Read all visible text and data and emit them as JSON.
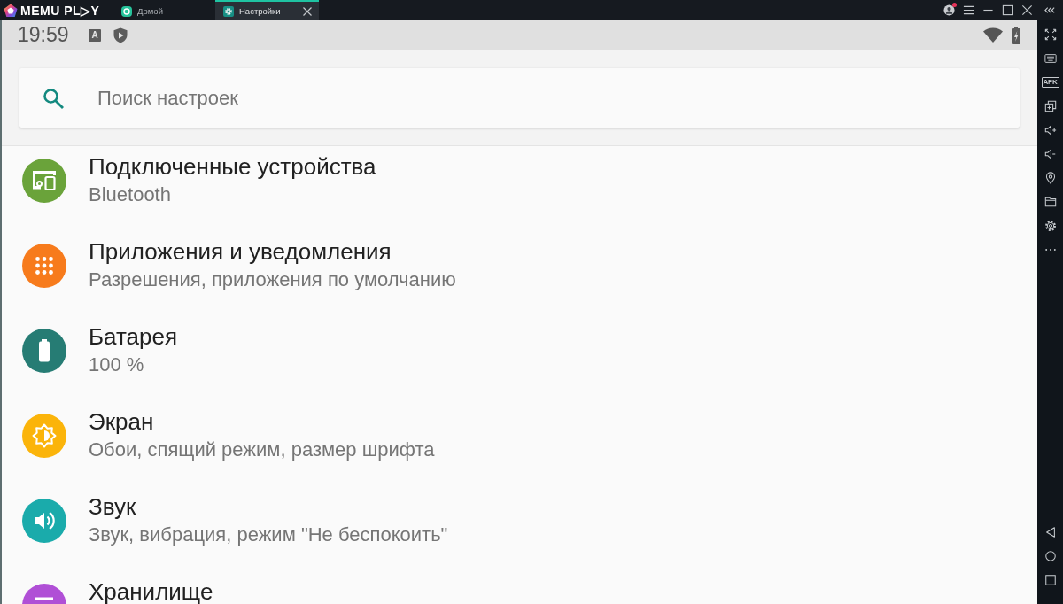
{
  "window": {
    "logo": "MEMU PL▷Y",
    "tabs": [
      {
        "kind": "home",
        "label": "Домой",
        "selected": false
      },
      {
        "kind": "settings",
        "label": "Настройки",
        "selected": true
      }
    ],
    "controls": [
      {
        "kind": "account",
        "notification": true
      },
      {
        "kind": "menu"
      },
      {
        "kind": "minimize"
      },
      {
        "kind": "maximize"
      },
      {
        "kind": "close"
      },
      {
        "kind": "collapse"
      }
    ]
  },
  "status_bar": {
    "time": "19:59",
    "input_indicator": "A"
  },
  "search": {
    "placeholder": "Поиск настроек"
  },
  "settings": [
    {
      "kind": "devices",
      "title": "Подключенные устройства",
      "subtitle": "Bluetooth",
      "color": "#6aa33a"
    },
    {
      "kind": "apps",
      "title": "Приложения и уведомления",
      "subtitle": "Разрешения, приложения по умолчанию",
      "color": "#f77b1c"
    },
    {
      "kind": "battery",
      "title": "Батарея",
      "subtitle": "100 %",
      "color": "#267c74"
    },
    {
      "kind": "display",
      "title": "Экран",
      "subtitle": "Обои, спящий режим, размер шрифта",
      "color": "#fbb40a"
    },
    {
      "kind": "sound",
      "title": "Звук",
      "subtitle": "Звук, вибрация, режим \"Не беспокоить\"",
      "color": "#1aabab"
    },
    {
      "kind": "storage",
      "title": "Хранилище",
      "color": "#b04fd6"
    }
  ],
  "toolbar": {
    "tools": [
      {
        "kind": "fullscreen"
      },
      {
        "kind": "keyboard"
      },
      {
        "kind": "apk",
        "label": "APK"
      },
      {
        "kind": "multiwindow"
      },
      {
        "kind": "volume_up"
      },
      {
        "kind": "volume_down"
      },
      {
        "kind": "location"
      },
      {
        "kind": "folder"
      },
      {
        "kind": "settings"
      },
      {
        "kind": "more"
      }
    ],
    "navigation": [
      {
        "kind": "back"
      },
      {
        "kind": "home"
      },
      {
        "kind": "recents"
      }
    ]
  }
}
